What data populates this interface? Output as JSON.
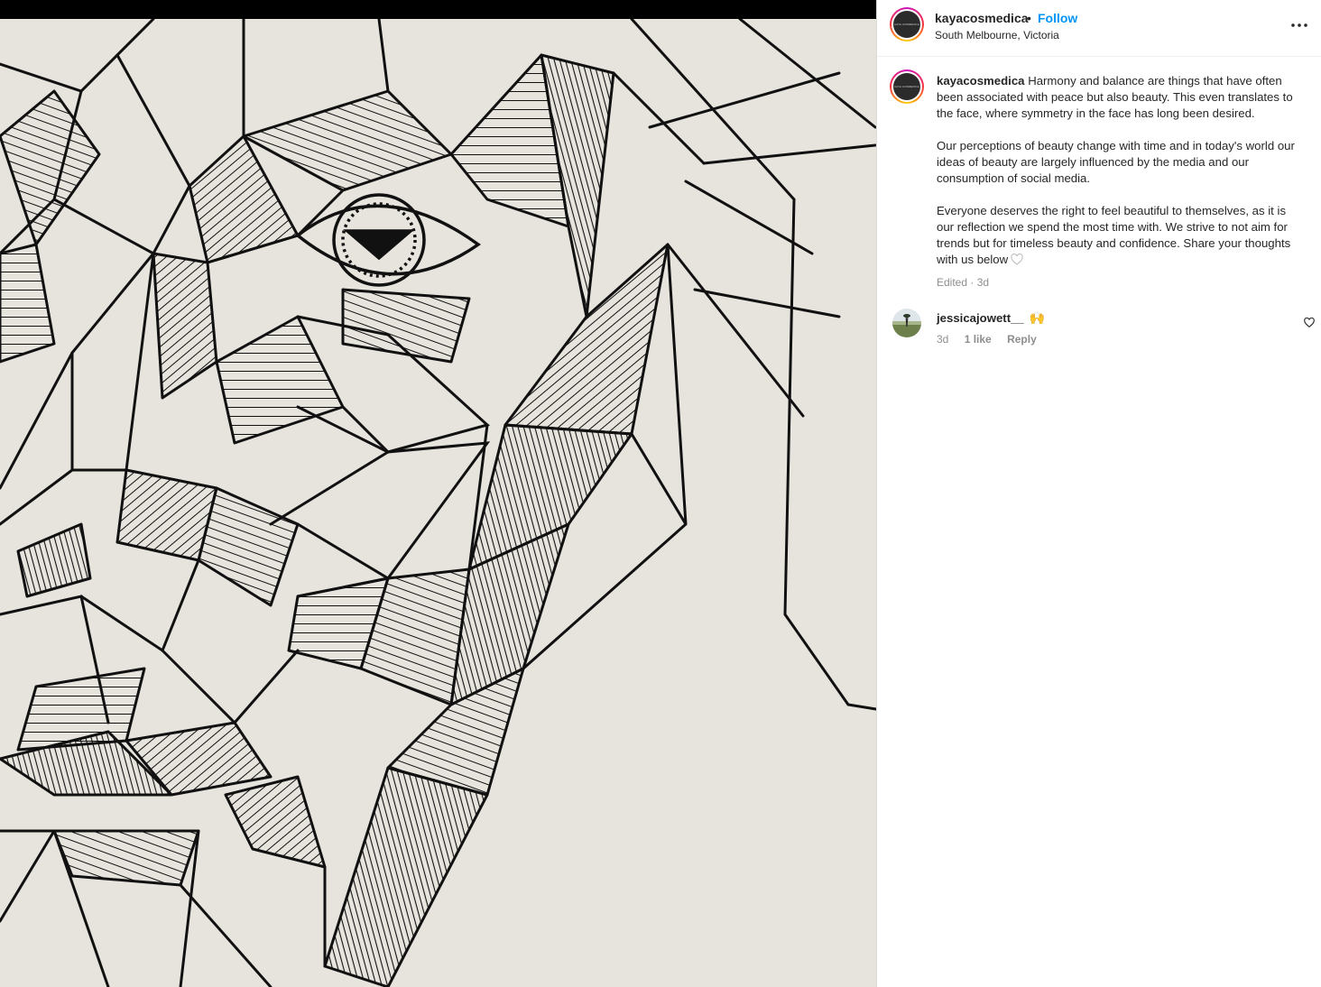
{
  "post": {
    "account": {
      "username": "kayacosmedica",
      "location": "South Melbourne, Victoria",
      "follow_label": "Follow",
      "separator": "•",
      "avatar_text": "KAYA COSMEDICA"
    },
    "media": {
      "description_icon": "geometric-line-art-face"
    },
    "caption": {
      "username": "kayacosmedica",
      "paragraphs": [
        "Harmony and balance are things that have often been associated with peace but also beauty. This even translates to the face, where symmetry in the face has long been desired.",
        "Our perceptions of beauty change with time and in today's world our ideas of beauty are largely influenced by the media and our consumption of social media.",
        "Everyone deserves the right to feel beautiful to themselves, as it is our reflection we spend the most time with. We strive to not aim for trends but for timeless beauty and confidence. Share your thoughts with us below"
      ],
      "edited_label": "Edited · 3d"
    },
    "comments": [
      {
        "username": "jessicajowett__",
        "text": "🙌",
        "time": "3d",
        "likes_label": "1 like",
        "reply_label": "Reply"
      }
    ]
  },
  "colors": {
    "link": "#0095f6",
    "text": "#262626",
    "muted": "#8e8e8e",
    "media_background": "#e7e3dd"
  },
  "icons": {
    "more": "more-horizontal-icon",
    "heart": "heart-outline-icon"
  }
}
